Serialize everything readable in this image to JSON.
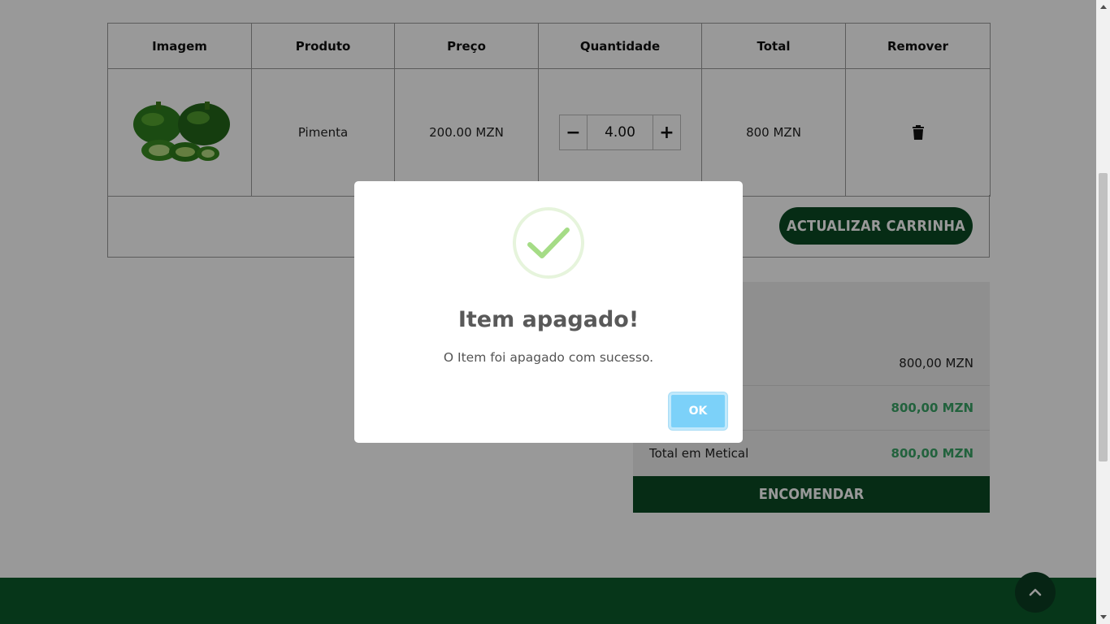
{
  "cart_table": {
    "headers": {
      "image": "Imagem",
      "product": "Produto",
      "price": "Preço",
      "quantity": "Quantidade",
      "total": "Total",
      "remove": "Remover"
    },
    "row": {
      "product": "Pimenta",
      "price": "200.00 MZN",
      "quantity": "4.00",
      "minus_symbol": "−",
      "plus_symbol": "+",
      "total": "800 MZN",
      "remove_icon": "trash-icon",
      "image_icon": "green-pepper-image"
    }
  },
  "update_button": "ACTUALIZAR CARRINHA",
  "totals": {
    "subtotal_value": "800,00 MZN",
    "shipping_value": "800,00 MZN",
    "total_label": "Total em Metical",
    "total_value": "800,00 MZN"
  },
  "order_button": "ENCOMENDAR",
  "modal": {
    "icon": "success-check-icon",
    "title": "Item apagado!",
    "text": "O Item foi apagado com sucesso.",
    "ok_label": "OK"
  },
  "colors": {
    "brand_green": "#0a4a24",
    "accent_green": "#3aa366",
    "ok_blue": "#7cd1f9",
    "check_green": "#a5dc86"
  }
}
